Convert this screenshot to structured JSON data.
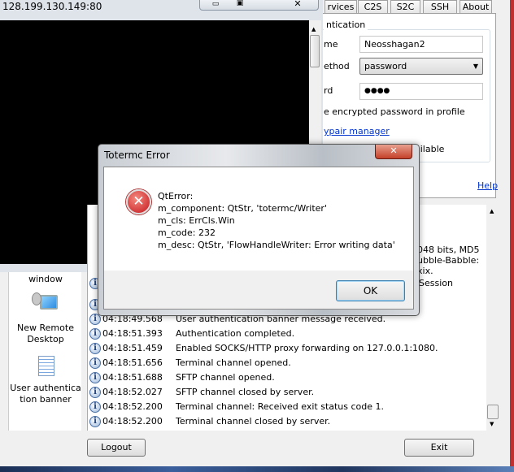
{
  "terminal": {
    "title": "128.199.130.149:80"
  },
  "tabs": [
    {
      "label": "rvices"
    },
    {
      "label": "C2S"
    },
    {
      "label": "S2C"
    },
    {
      "label": "SSH"
    },
    {
      "label": "About"
    }
  ],
  "auth": {
    "group_label": "ntication",
    "username_label": "me",
    "username_value": "Neosshagan2",
    "method_label": "ethod",
    "method_value": "password",
    "password_label": "rd",
    "password_value": "●●●●",
    "store_password_label": "e encrypted password in profile",
    "keypair_link": "ypair manager",
    "available_text": "ailable",
    "help_link": "Help"
  },
  "sidebar": {
    "items": [
      {
        "label": "window"
      },
      {
        "label": "New Remote Desktop"
      },
      {
        "label": "User authentication banner"
      }
    ]
  },
  "log": {
    "partial": [
      "048 bits, MD5",
      "ubble-Babble:",
      "xix.",
      "Session"
    ],
    "rows": [
      {
        "time": "04:18:49.568",
        "msg": "User authentication banner message received."
      },
      {
        "time": "04:18:51.393",
        "msg": "Authentication completed."
      },
      {
        "time": "04:18:51.459",
        "msg": "Enabled SOCKS/HTTP proxy forwarding on 127.0.0.1:1080."
      },
      {
        "time": "04:18:51.656",
        "msg": "Terminal channel opened."
      },
      {
        "time": "04:18:51.688",
        "msg": "SFTP channel opened."
      },
      {
        "time": "04:18:52.027",
        "msg": "SFTP channel closed by server."
      },
      {
        "time": "04:18:52.200",
        "msg": "Terminal channel: Received exit status code 1."
      },
      {
        "time": "04:18:52.200",
        "msg": "Terminal channel closed by server."
      }
    ]
  },
  "buttons": {
    "logout": "Logout",
    "exit": "Exit"
  },
  "dialog": {
    "title": "Totermc Error",
    "lines": [
      "QtError:",
      "m_component: QtStr, 'totermc/Writer'",
      "m_cls: ErrCls.Win",
      "m_code: 232",
      "m_desc: QtStr, 'FlowHandleWriter: Error writing data'"
    ],
    "ok": "OK"
  }
}
